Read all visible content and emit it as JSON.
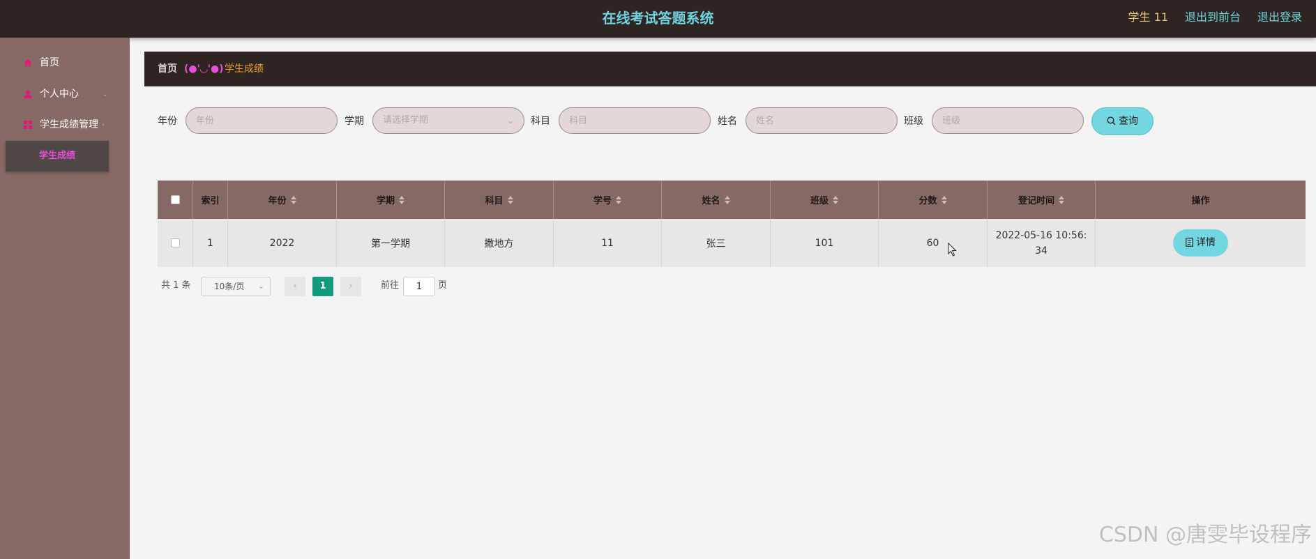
{
  "header": {
    "title": "在线考试答题系统",
    "user": "学生 11",
    "front_link": "退出到前台",
    "logout_link": "退出登录"
  },
  "sidebar": {
    "items": [
      {
        "label": "首页",
        "icon": "home-icon"
      },
      {
        "label": "个人中心",
        "icon": "user-icon"
      },
      {
        "label": "学生成绩管理",
        "icon": "grid-icon"
      }
    ],
    "sub_item": "学生成绩"
  },
  "breadcrumb": {
    "home": "首页",
    "separator": "(●'◡'●)",
    "current": "学生成绩"
  },
  "search": {
    "year_label": "年份",
    "year_placeholder": "年份",
    "term_label": "学期",
    "term_placeholder": "请选择学期",
    "subject_label": "科目",
    "subject_placeholder": "科目",
    "name_label": "姓名",
    "name_placeholder": "姓名",
    "class_label": "班级",
    "class_placeholder": "班级",
    "query_button": "查询"
  },
  "table": {
    "headers": {
      "index": "索引",
      "year": "年份",
      "term": "学期",
      "subject": "科目",
      "student_no": "学号",
      "name": "姓名",
      "class": "班级",
      "score": "分数",
      "time": "登记时间",
      "action": "操作"
    },
    "rows": [
      {
        "index": "1",
        "year": "2022",
        "term": "第一学期",
        "subject": "撒地方",
        "student_no": "11",
        "name": "张三",
        "class": "101",
        "score": "60",
        "time": "2022-05-16 10:56:34",
        "action": "详情"
      }
    ]
  },
  "pagination": {
    "total": "共 1 条",
    "page_size": "10条/页",
    "current": "1",
    "goto_label": "前往",
    "goto_value": "1",
    "page_suffix": "页"
  },
  "watermark": "CSDN @唐雯毕设程序"
}
